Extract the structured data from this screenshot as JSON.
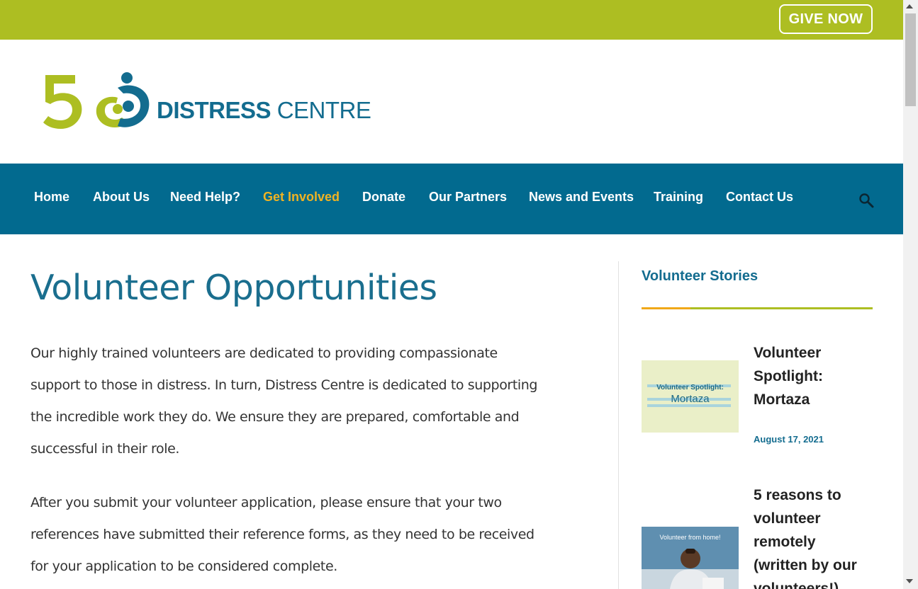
{
  "top_bar": {
    "give_label": "GIVE NOW"
  },
  "logo": {
    "word_bold": "DISTRESS",
    "word_light": "CENTRE"
  },
  "nav": {
    "items": [
      {
        "label": "Home"
      },
      {
        "label": "About Us"
      },
      {
        "label": "Need Help?"
      },
      {
        "label": "Get Involved",
        "active": true
      },
      {
        "label": "Donate"
      },
      {
        "label": "Our Partners"
      },
      {
        "label": "News and Events"
      },
      {
        "label": "Training"
      },
      {
        "label": "Contact Us"
      }
    ],
    "search_icon": "search-icon"
  },
  "main": {
    "title": "Volunteer Opportunities",
    "para1": [
      "Our highly trained volunteers are dedicated to providing compassionate",
      "support to those in distress.  In turn, Distress Centre is dedicated to supporting",
      "the incredible work they do. We ensure they are prepared, comfortable and",
      "successful in their role."
    ],
    "para2": [
      "After you submit your volunteer application, please ensure that your two",
      "references have submitted their reference forms, as they need to be received",
      "for your application to be considered complete."
    ]
  },
  "sidebar": {
    "title": "Volunteer Stories",
    "posts": [
      {
        "title_lines": [
          "Volunteer",
          "Spotlight:",
          "Mortaza"
        ],
        "date": "August 17, 2021",
        "thumb_line1": "Volunteer Spotlight:",
        "thumb_line2": "Mortaza"
      },
      {
        "title_lines": [
          "5 reasons to",
          "volunteer",
          "remotely",
          "(written by our",
          "volunteers!)"
        ],
        "thumb_caption": "Volunteer from home!"
      }
    ]
  },
  "colors": {
    "top_bar": "#adbe22",
    "nav_bg": "#026a8f",
    "nav_active": "#f0b323",
    "heading_blue": "#1a6e8e",
    "accent_orange": "#f0a818"
  }
}
